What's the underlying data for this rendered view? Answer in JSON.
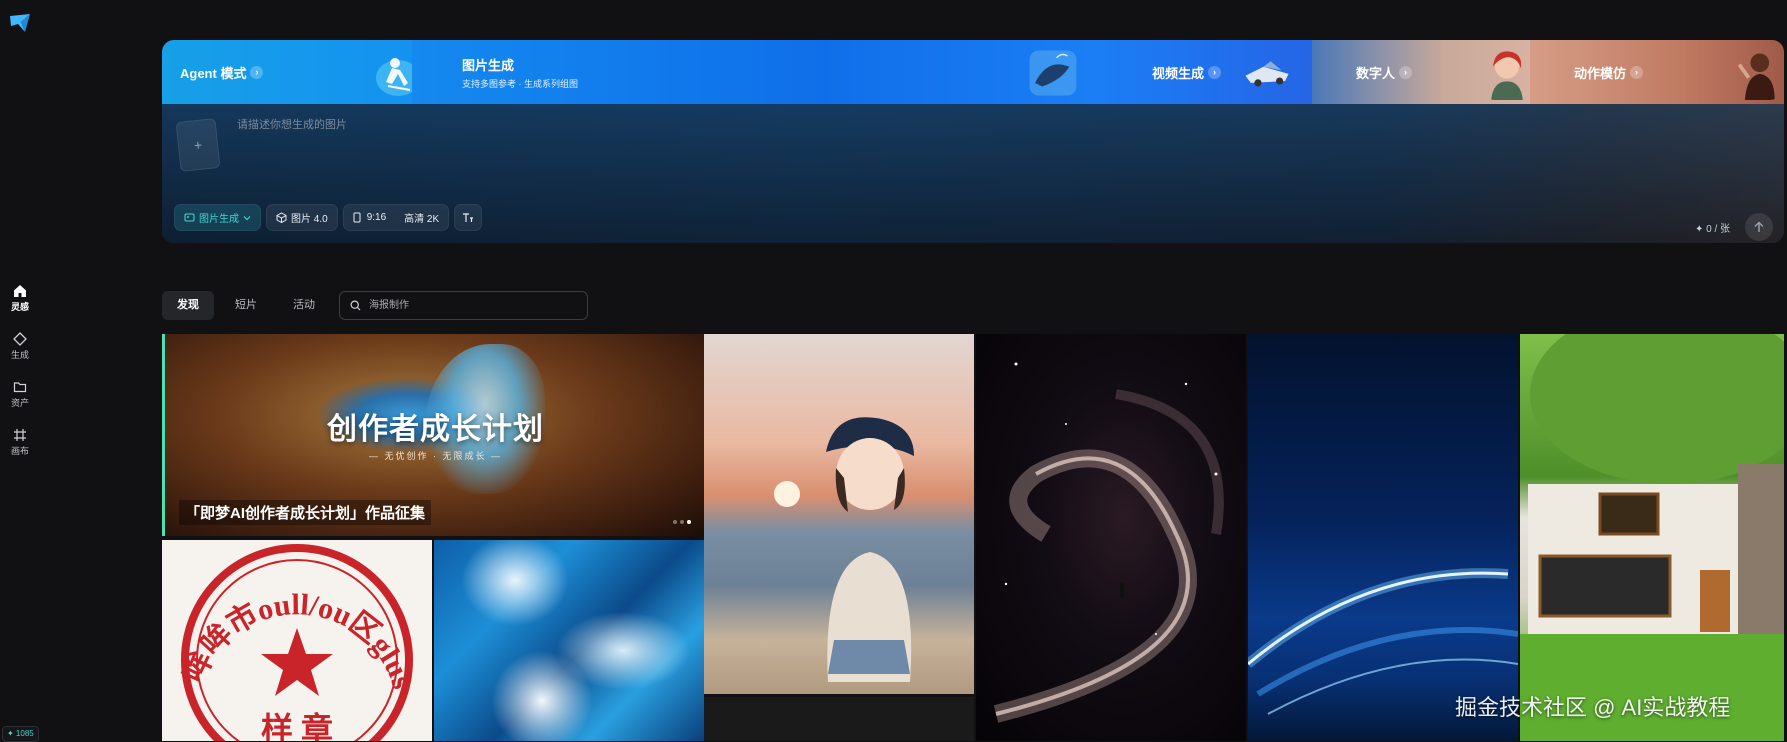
{
  "sidebar": {
    "items": [
      {
        "label": "灵感",
        "icon": "home-icon",
        "active": true
      },
      {
        "label": "生成",
        "icon": "diamond-icon"
      },
      {
        "label": "资产",
        "icon": "folder-icon"
      },
      {
        "label": "画布",
        "icon": "canvas-icon"
      }
    ],
    "credits": "✦ 1085"
  },
  "modes": {
    "agent": {
      "label": "Agent 模式"
    },
    "image": {
      "label": "图片生成",
      "sub": "支持多图参考 · 生成系列组图"
    },
    "video": {
      "label": "视频生成"
    },
    "digital_human": {
      "label": "数字人"
    },
    "motion": {
      "label": "动作模仿"
    }
  },
  "prompt": {
    "placeholder": "请描述你想生成的图片",
    "add_icon": "+",
    "count": "✦ 0 / 张"
  },
  "toolbar": {
    "type_label": "图片生成",
    "model_label": "图片 4.0",
    "ratio_label": "9:16",
    "quality_label": "高清 2K"
  },
  "tabs": [
    {
      "label": "发现",
      "active": true
    },
    {
      "label": "短片"
    },
    {
      "label": "活动"
    }
  ],
  "search": {
    "placeholder": "海报制作"
  },
  "banner": {
    "headline": "创作者成长计划",
    "tagline": "— 无优创作 · 无限成长 —",
    "caption": "「即梦AI创作者成长计划」作品征集"
  },
  "seal": {
    "text": "哞哞市oull/ou区gluson局",
    "bottom": "样 章"
  },
  "watermark": "掘金技术社区 @ AI实战教程",
  "colors": {
    "accent": "#46d5d0",
    "background": "#111113",
    "banner_border": "#4de0b2"
  }
}
